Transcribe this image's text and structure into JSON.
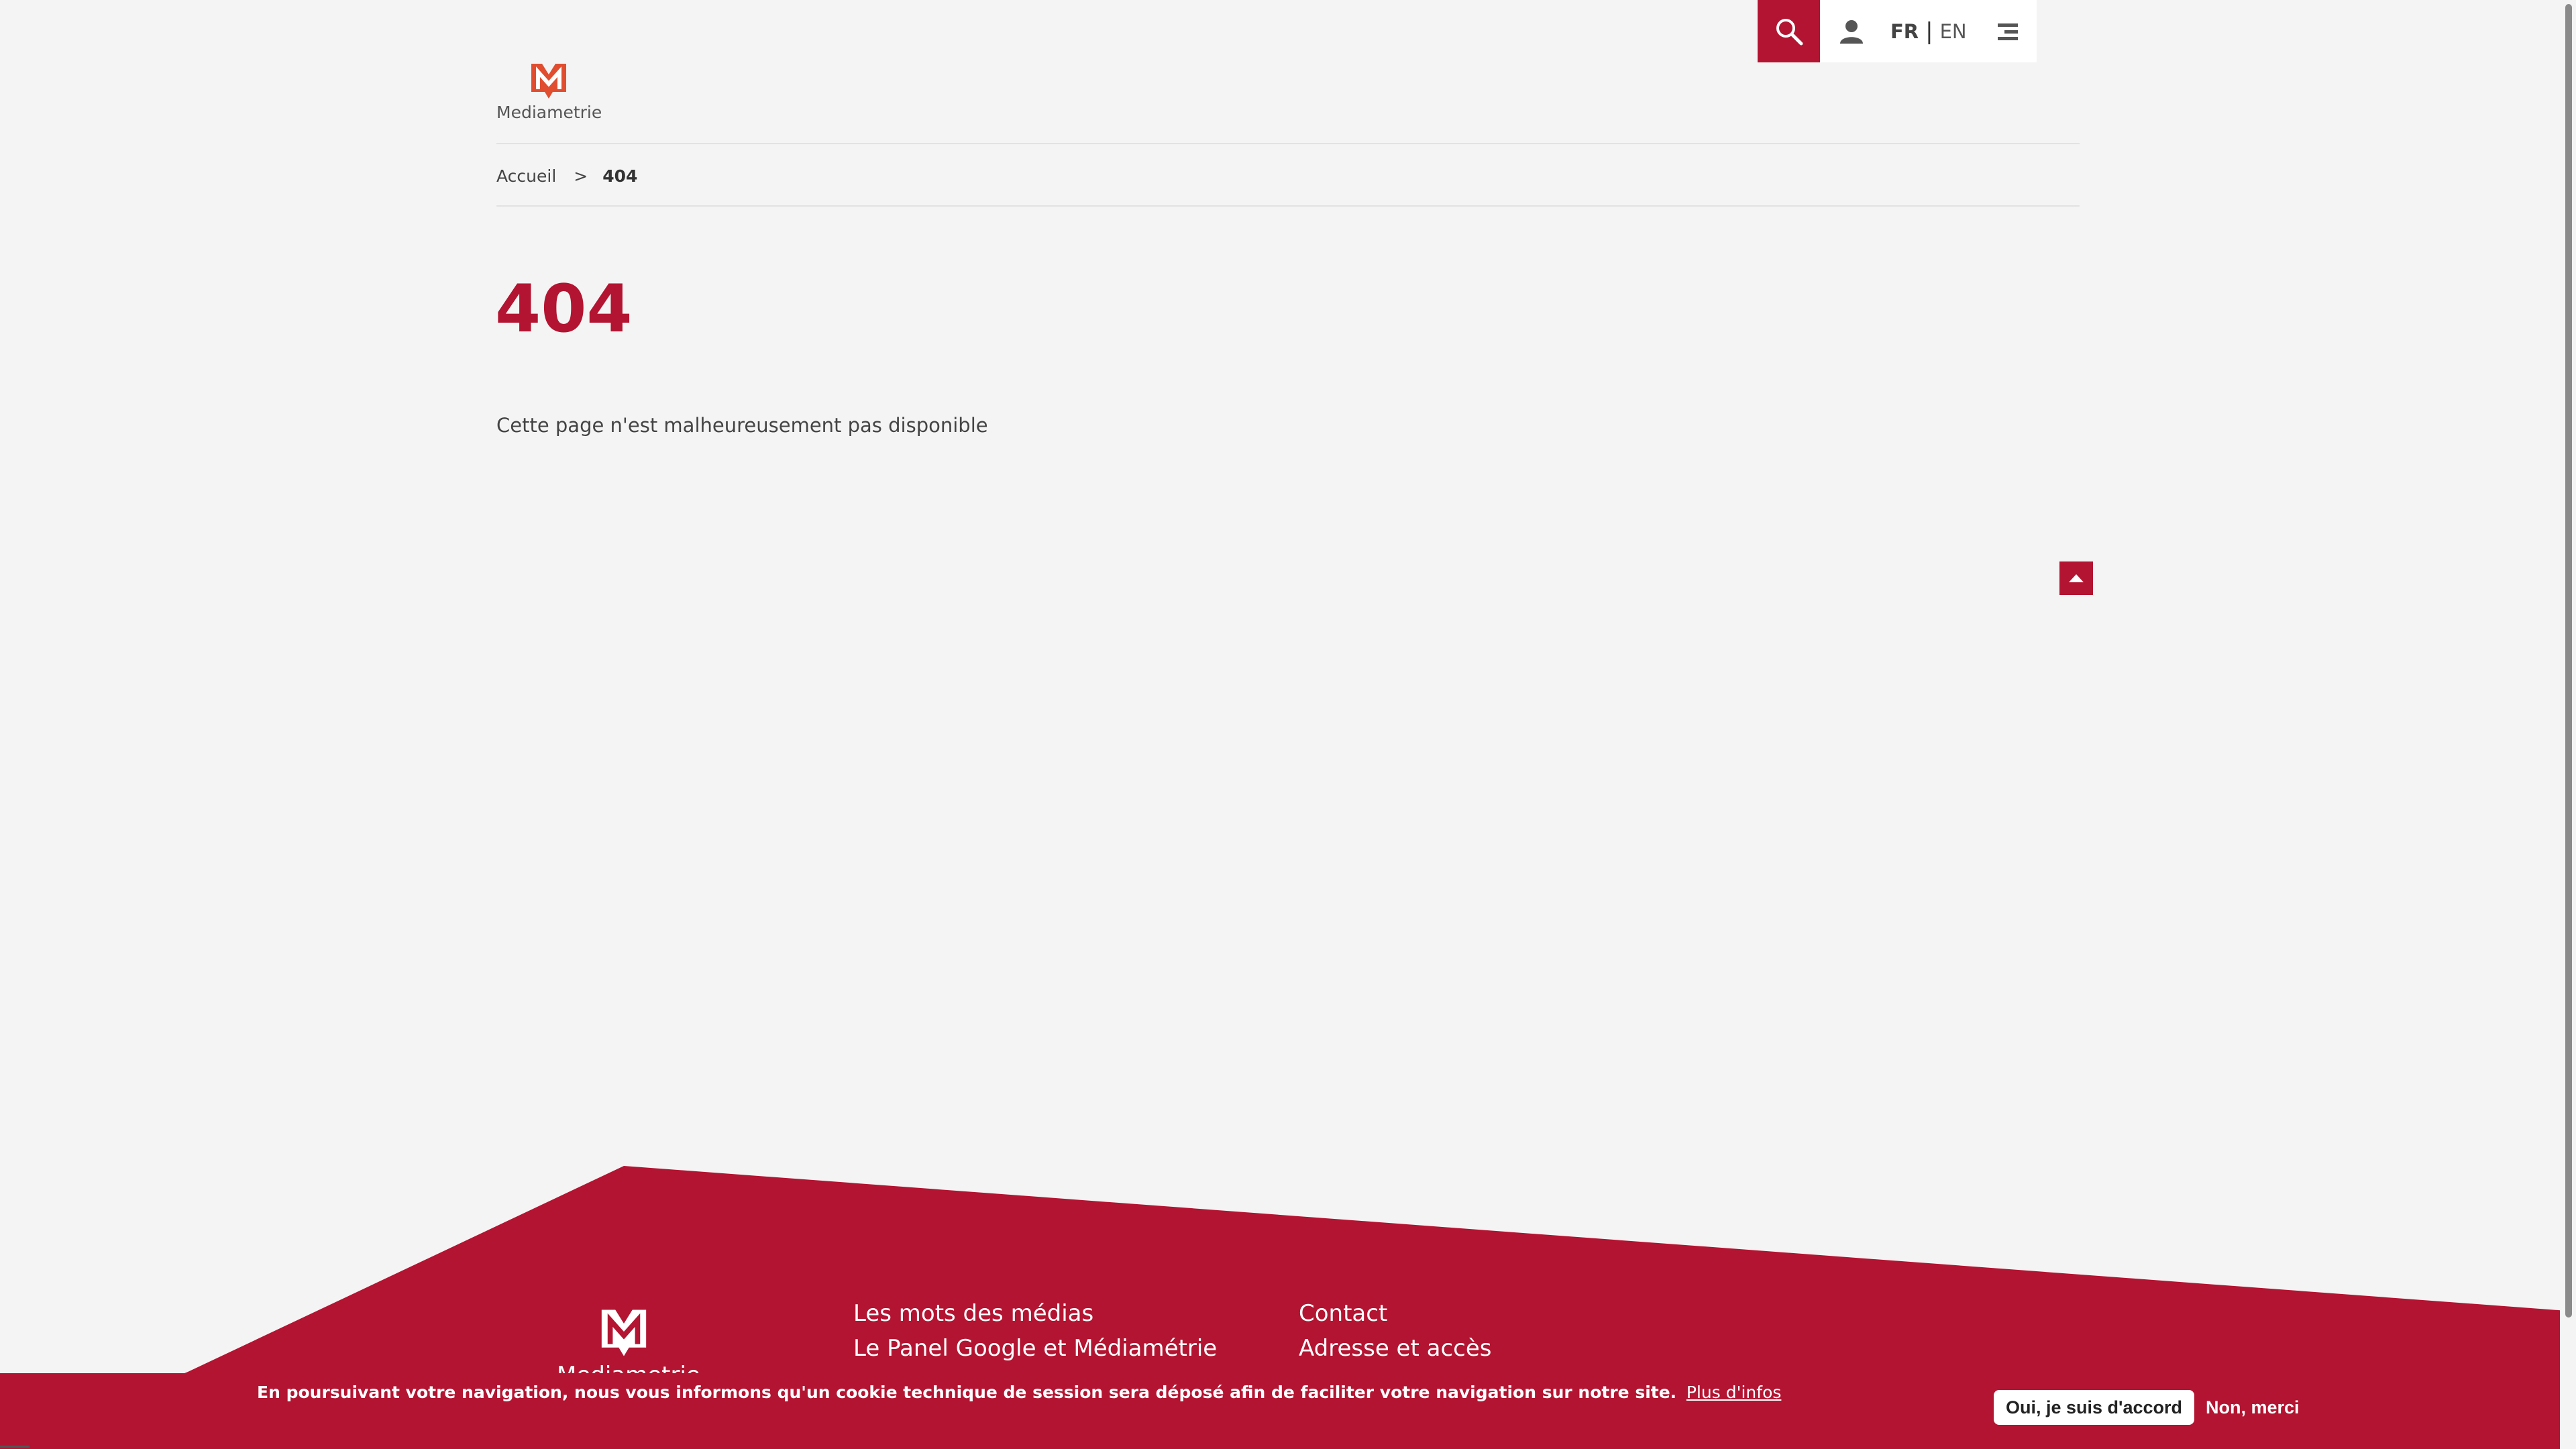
{
  "header": {
    "logo_text": "Mediametrie",
    "languages": {
      "active": "FR",
      "separator": "|",
      "other": "EN"
    },
    "icons": {
      "search": "search-icon",
      "account": "user-icon",
      "menu": "menu-icon"
    }
  },
  "breadcrumb": {
    "home": "Accueil",
    "separator": ">",
    "current": "404"
  },
  "main": {
    "title": "404",
    "message": "Cette page n'est malheureusement pas disponible"
  },
  "footer": {
    "logo_text": "Mediametrie",
    "col1": [
      "Les mots des médias",
      "Le Panel Google et Médiamétrie"
    ],
    "col2": [
      "Contact",
      "Adresse et accès"
    ]
  },
  "cookie": {
    "text": "En poursuivant votre navigation, nous vous informons qu'un cookie technique de session sera déposé afin de faciliter votre navigation sur notre site.",
    "more_link": "Plus d'infos",
    "accept": "Oui, je suis d'accord",
    "refuse": "Non, merci"
  },
  "colors": {
    "brand": "#b31431",
    "background": "#f4f4f4",
    "logo_orange": "#e04e2f"
  }
}
